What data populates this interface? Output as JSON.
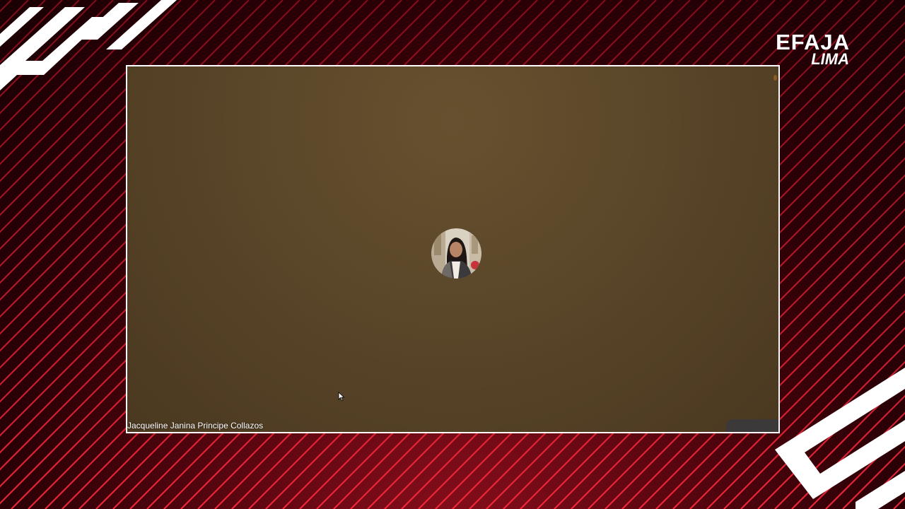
{
  "brand": {
    "name": "EFAJA",
    "location": "LIMA"
  },
  "meeting": {
    "participant_name": "Jacqueline Janina Principe Collazos",
    "avatar_icon": "participant-avatar-photo"
  },
  "colors": {
    "background_dark": "#2a0006",
    "background_red": "#8a0f1c",
    "stripe": "#d0182e",
    "frame_border": "#ffffff",
    "meeting_bg": "#5a4629"
  }
}
